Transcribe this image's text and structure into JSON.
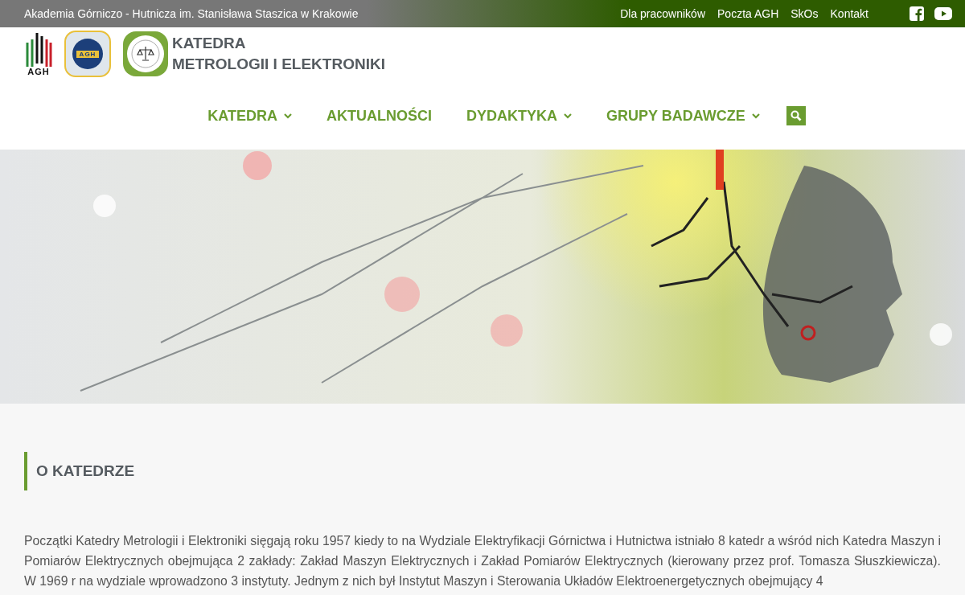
{
  "top_bar": {
    "institution": "Akademia Górniczo - Hutnicza im. Stanisława Staszica w Krakowie",
    "links": [
      "Dla pracowników",
      "Poczta AGH",
      "SkOs",
      "Kontakt"
    ],
    "social": [
      {
        "kind": "facebook"
      },
      {
        "kind": "youtube"
      }
    ]
  },
  "header": {
    "agh_logo_text": "AGH",
    "logo_ring_text": "AGH",
    "title_lines": [
      "KATEDRA",
      "METROLOGII I ELEKTRONIKI"
    ]
  },
  "nav": {
    "items": [
      {
        "label": "KATEDRA",
        "dropdown": true
      },
      {
        "label": "AKTUALNOŚCI",
        "dropdown": false
      },
      {
        "label": "DYDAKTYKA",
        "dropdown": true
      },
      {
        "label": "GRUPY BADAWCZE",
        "dropdown": true
      }
    ]
  },
  "section": {
    "heading": "O KATEDRZE",
    "paragraph": "Początki Katedry Metrologii i Elektroniki sięgają roku 1957 kiedy to na Wydziale Elektryfikacji Górnictwa i Hutnictwa istniało 8 katedr a wśród nich Katedra Maszyn i Pomiarów Elektrycznych obejmująca 2 zakłady: Zakład Maszyn Elektrycznych i Zakład Pomiarów Elektrycznych (kierowany przez prof. Tomasza Słuszkiewicza). W 1969 r na wydziale wprowadzono 3 instytuty. Jednym z nich był Instytut Maszyn i Sterowania Układów Elektroenergetycznych obejmujący 4"
  }
}
